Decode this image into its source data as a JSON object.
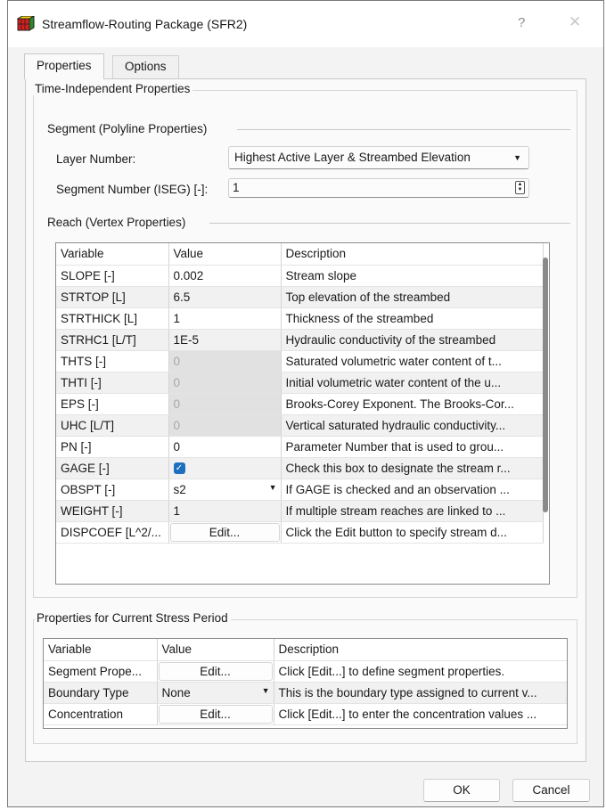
{
  "window": {
    "title": "Streamflow-Routing Package (SFR2)",
    "help_glyph": "?",
    "close_glyph": "✕"
  },
  "tabs": [
    {
      "label": "Properties"
    },
    {
      "label": "Options"
    }
  ],
  "time_independent": {
    "title": "Time-Independent Properties",
    "segment": {
      "title": "Segment (Polyline Properties)",
      "layer_label": "Layer Number:",
      "layer_value": "Highest Active Layer & Streambed Elevation",
      "iseg_label": "Segment Number (ISEG) [-]:",
      "iseg_value": "1"
    },
    "reach": {
      "title": "Reach (Vertex Properties)",
      "columns": [
        "Variable",
        "Value",
        "Description"
      ],
      "rows": [
        {
          "variable": "SLOPE [-]",
          "value": "0.002",
          "description": "Stream slope"
        },
        {
          "variable": "STRTOP [L]",
          "value": "6.5",
          "description": "Top elevation of the streambed"
        },
        {
          "variable": "STRTHICK [L]",
          "value": "1",
          "description": "Thickness of the streambed"
        },
        {
          "variable": "STRHC1 [L/T]",
          "value": "1E-5",
          "description": "Hydraulic conductivity of the streambed"
        },
        {
          "variable": "THTS [-]",
          "value": "0",
          "description": "Saturated volumetric water content of t..."
        },
        {
          "variable": "THTI [-]",
          "value": "0",
          "description": "Initial volumetric water content of the u..."
        },
        {
          "variable": "EPS [-]",
          "value": "0",
          "description": "Brooks-Corey Exponent. The Brooks-Cor..."
        },
        {
          "variable": "UHC [L/T]",
          "value": "0",
          "description": "Vertical saturated hydraulic conductivity..."
        },
        {
          "variable": "PN [-]",
          "value": "0",
          "description": "Parameter Number that is used to grou..."
        },
        {
          "variable": "GAGE [-]",
          "value": "checked",
          "description": "Check this box to designate the stream r..."
        },
        {
          "variable": "OBSPT [-]",
          "value": "s2",
          "description": "If GAGE is checked and an observation ..."
        },
        {
          "variable": "WEIGHT [-]",
          "value": "1",
          "description": "If multiple stream reaches are linked to ..."
        },
        {
          "variable": "DISPCOEF [L^2/...",
          "value": "Edit...",
          "description": "Click the Edit button to specify stream d..."
        }
      ]
    }
  },
  "stress_period": {
    "title": "Properties for Current Stress Period",
    "columns": [
      "Variable",
      "Value",
      "Description"
    ],
    "rows": [
      {
        "variable": "Segment Prope...",
        "value": "Edit...",
        "description": "Click [Edit...] to define segment properties."
      },
      {
        "variable": "Boundary Type",
        "value": "None",
        "description": "This is the boundary type assigned to current v..."
      },
      {
        "variable": "Concentration",
        "value": "Edit...",
        "description": "Click [Edit...] to enter the concentration values ..."
      }
    ]
  },
  "buttons": {
    "ok": "OK",
    "cancel": "Cancel"
  },
  "colors": {
    "accent": "#1f6fbf",
    "dialog_bg": "#f3f3f3",
    "disabled_cell": "#e1e1e1"
  }
}
